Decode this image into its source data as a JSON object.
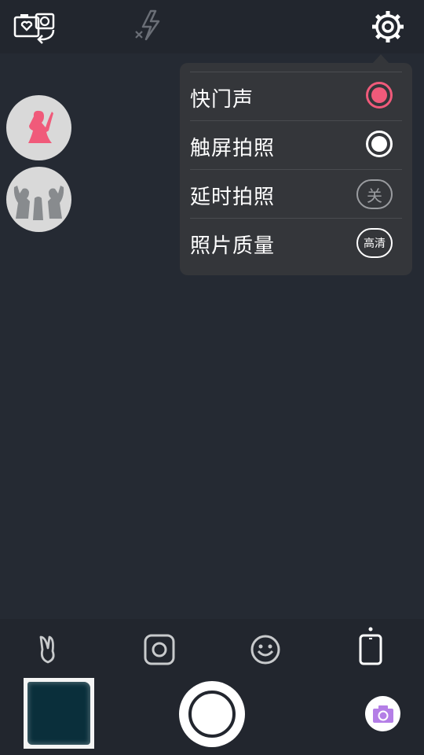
{
  "colors": {
    "accent_pink": "#f05a7a",
    "accent_purple": "#b47ee6",
    "background": "#252a33",
    "menu_bg": "#34363a"
  },
  "topbar": {
    "icons": [
      "switch-camera-icon",
      "flash-off-icon",
      "settings-gear-icon"
    ]
  },
  "pose_buttons": [
    "single-pose-icon",
    "group-pose-icon"
  ],
  "settings_menu": {
    "items": [
      {
        "label": "快门声",
        "control": "radio-on-pink"
      },
      {
        "label": "触屏拍照",
        "control": "radio-on-white"
      },
      {
        "label": "延时拍照",
        "control_text": "关"
      },
      {
        "label": "照片质量",
        "control_text": "高清"
      }
    ]
  },
  "mode_bar": {
    "icons": [
      "bunny-ears-icon",
      "instagram-frame-icon",
      "smiley-icon",
      "phone-full-icon"
    ]
  },
  "bottom": {
    "icons": [
      "gallery-thumbnail",
      "shutter-button",
      "camera-icon"
    ]
  }
}
